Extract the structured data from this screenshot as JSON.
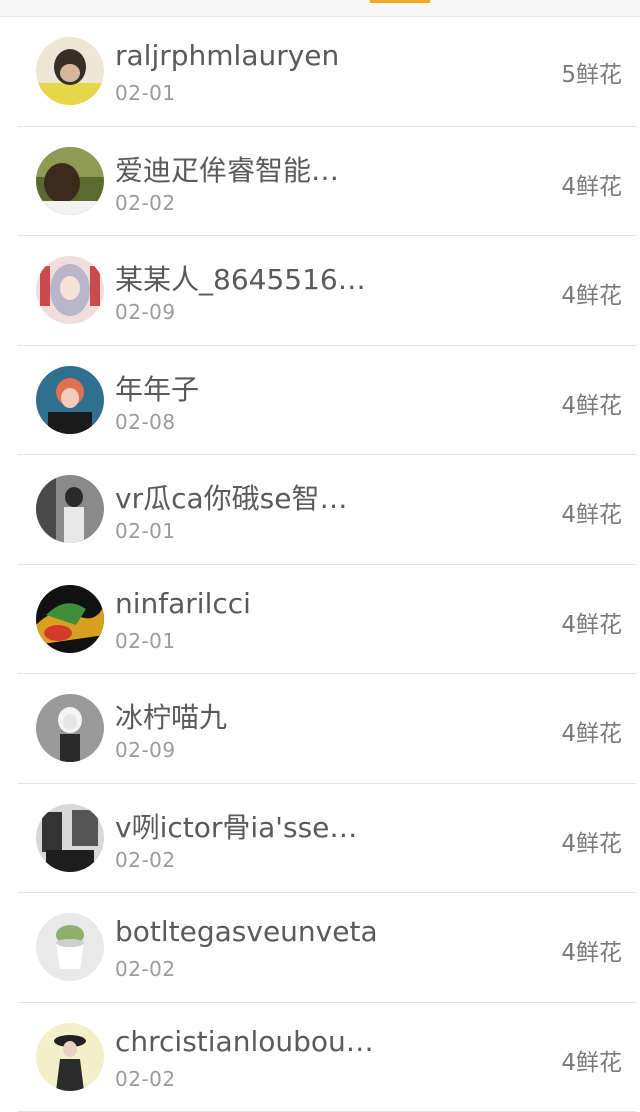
{
  "colors": {
    "accent": "#f5a623",
    "name_text": "#5a5a5a",
    "date_text": "#9b9b9b",
    "divider": "#e4e4e4"
  },
  "rows": [
    {
      "name": "raljrphmlauryen",
      "date": "02-01",
      "flowers": "5鲜花",
      "avatar": "user-avatar-1"
    },
    {
      "name": "爱迪疋侔睿智能…",
      "date": "02-02",
      "flowers": "4鲜花",
      "avatar": "user-avatar-2"
    },
    {
      "name": "某某人_8645516…",
      "date": "02-09",
      "flowers": "4鲜花",
      "avatar": "user-avatar-3"
    },
    {
      "name": "年年子",
      "date": "02-08",
      "flowers": "4鲜花",
      "avatar": "user-avatar-4"
    },
    {
      "name": "vr瓜ca你硪se智…",
      "date": "02-01",
      "flowers": "4鲜花",
      "avatar": "user-avatar-5"
    },
    {
      "name": "ninfarilcci",
      "date": "02-01",
      "flowers": "4鲜花",
      "avatar": "user-avatar-6"
    },
    {
      "name": "冰柠喵九",
      "date": "02-09",
      "flowers": "4鲜花",
      "avatar": "user-avatar-7"
    },
    {
      "name": "v咧ictor骨ia'sse…",
      "date": "02-02",
      "flowers": "4鲜花",
      "avatar": "user-avatar-8"
    },
    {
      "name": "botltegasveunveta",
      "date": "02-02",
      "flowers": "4鲜花",
      "avatar": "user-avatar-9"
    },
    {
      "name": "chrcistianloubou…",
      "date": "02-02",
      "flowers": "4鲜花",
      "avatar": "user-avatar-10"
    }
  ]
}
